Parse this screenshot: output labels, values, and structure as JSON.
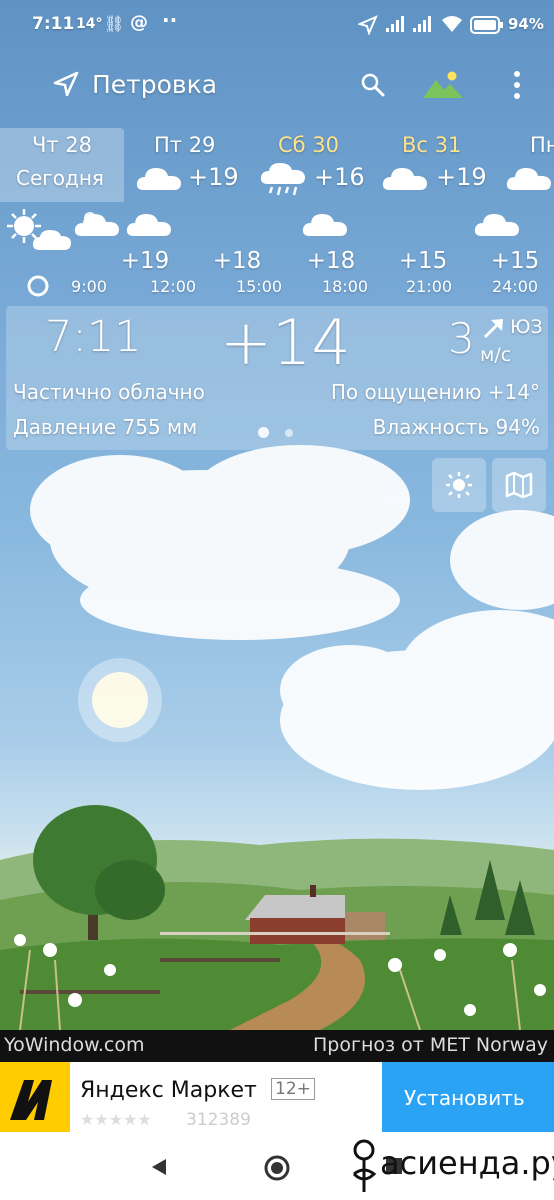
{
  "status": {
    "time": "7:11",
    "temp": "14°",
    "battery": "94%"
  },
  "location": "Петровка",
  "days": [
    {
      "label": "Чт 28",
      "sub": "Сегодня",
      "temp": "",
      "color": "#ffffff"
    },
    {
      "label": "Пт 29",
      "temp": "+19",
      "color": "#ffffff"
    },
    {
      "label": "Сб 30",
      "temp": "+16",
      "color": "#ffe38a"
    },
    {
      "label": "Вс 31",
      "temp": "+19",
      "color": "#ffe38a"
    },
    {
      "label": "Пн",
      "temp": "",
      "color": "#ffffff"
    }
  ],
  "hourly": [
    {
      "time": "9:00",
      "temp": ""
    },
    {
      "time": "12:00",
      "temp": "+19"
    },
    {
      "time": "15:00",
      "temp": "+18"
    },
    {
      "time": "18:00",
      "temp": "+18"
    },
    {
      "time": "21:00",
      "temp": "+15"
    },
    {
      "time": "24:00",
      "temp": "+15"
    }
  ],
  "current": {
    "time": "7:11",
    "temp": "+14",
    "wind_speed": "3",
    "wind_dir": "ЮЗ",
    "wind_unit": "м/с",
    "condition": "Частично облачно",
    "feels": "По ощущению +14°",
    "pressure": "Давление 755 мм",
    "humidity": "Влажность 94%"
  },
  "credits": {
    "left": "YoWindow.com",
    "right": "Прогноз от MET Norway"
  },
  "ad": {
    "title": "Яндекс Маркет",
    "age": "12+",
    "rating_count": "312389",
    "install": "Установить"
  },
  "watermark": "асиенда.ру",
  "colors": {
    "install_bg": "#2aa3f5",
    "weekend": "#ffe38a"
  }
}
